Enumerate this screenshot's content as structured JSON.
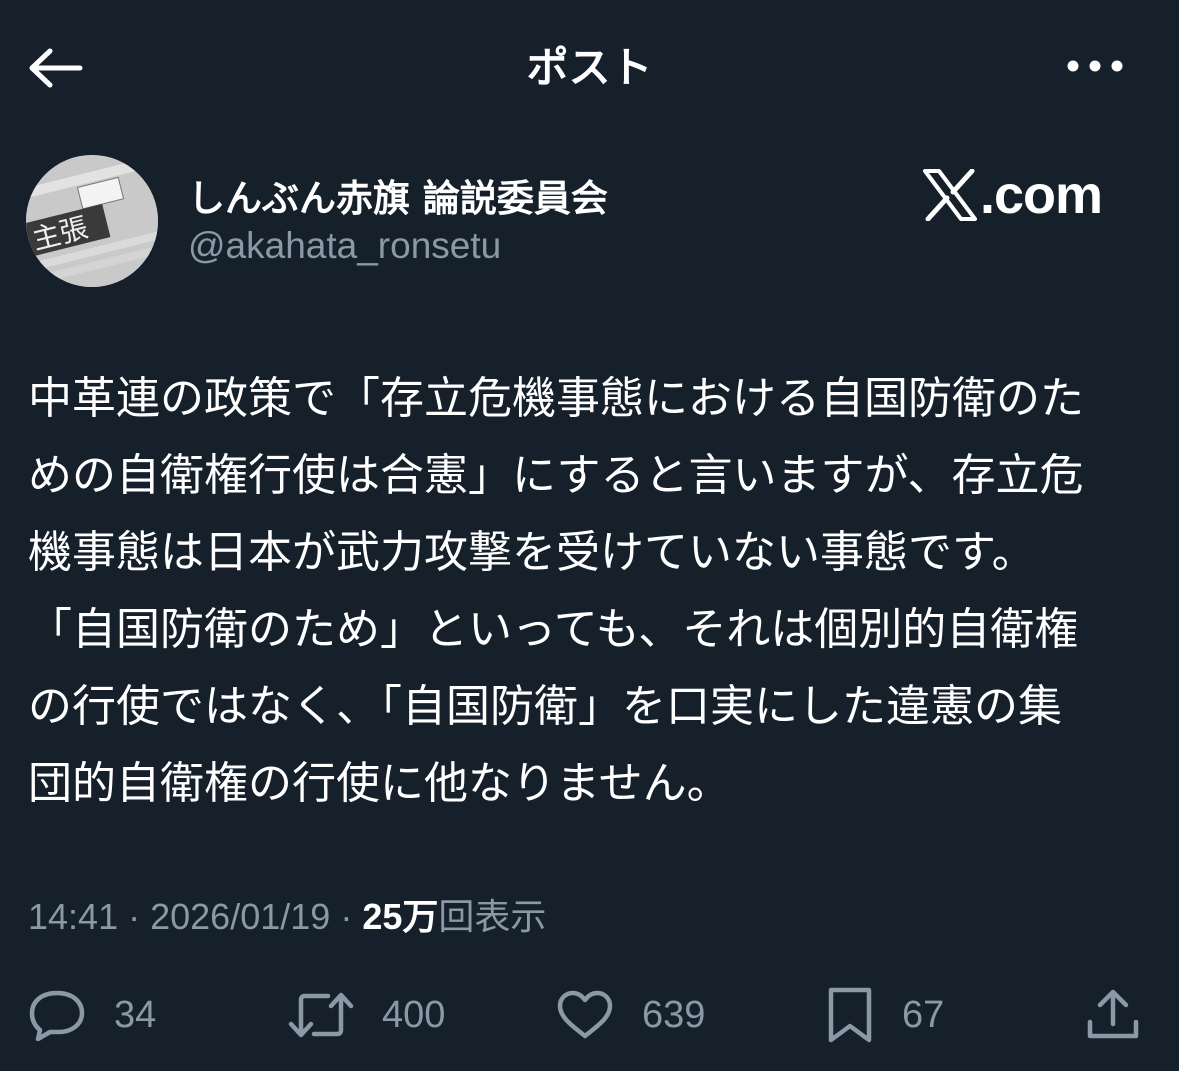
{
  "header": {
    "title": "ポスト"
  },
  "author": {
    "display_name": "しんぶん赤旗 論説委員会",
    "handle": "@akahata_ronsetu",
    "avatar_text": "主張"
  },
  "watermark": {
    "text": ".com"
  },
  "tweet": {
    "lines": [
      "中革連の政策で「存立危機事態における自国防衛のた",
      "めの自衛権行使は合憲」にすると言いますが、存立危",
      "機事態は日本が武力攻撃を受けていない事態です。",
      "「自国防衛のため」といっても、それは個別的自衛権",
      "の行使ではなく、「自国防衛」を口実にした違憲の集",
      "団的自衛権の行使に他なりません。"
    ]
  },
  "meta": {
    "time": "14:41",
    "date": "2026/01/19",
    "views_count": "25万",
    "views_label": "回表示"
  },
  "actions": {
    "replies": "34",
    "reposts": "400",
    "likes": "639",
    "bookmarks": "67"
  },
  "icons": [
    "arrow-left-icon",
    "more-icon",
    "x-logo-icon",
    "reply-icon",
    "repost-icon",
    "like-icon",
    "bookmark-icon",
    "share-icon"
  ]
}
